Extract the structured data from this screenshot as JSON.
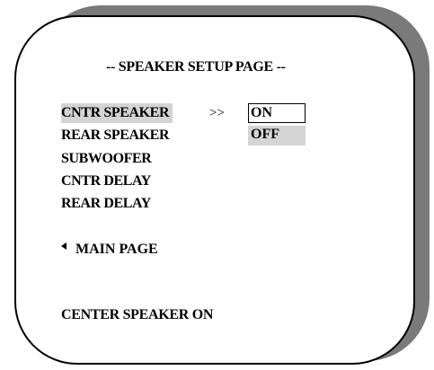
{
  "osd": {
    "title": "-- SPEAKER SETUP PAGE --",
    "menu_items": [
      {
        "label": "CNTR SPEAKER",
        "selected": true
      },
      {
        "label": "REAR SPEAKER",
        "selected": false
      },
      {
        "label": "SUBWOOFER",
        "selected": false
      },
      {
        "label": "CNTR DELAY",
        "selected": false
      },
      {
        "label": "REAR DELAY",
        "selected": false
      }
    ],
    "submenu_arrow": ">>",
    "options": [
      {
        "label": "ON",
        "current": true
      },
      {
        "label": "OFF",
        "current": false
      }
    ],
    "back_icon": "left-triangle-icon",
    "main_page_label": "MAIN PAGE",
    "status_text": "CENTER SPEAKER ON"
  },
  "colors": {
    "panel_background": "#ffffff",
    "panel_border": "#000000",
    "shadow": "#7a7a7a",
    "highlight": "#d4d4d4",
    "text": "#000000"
  }
}
